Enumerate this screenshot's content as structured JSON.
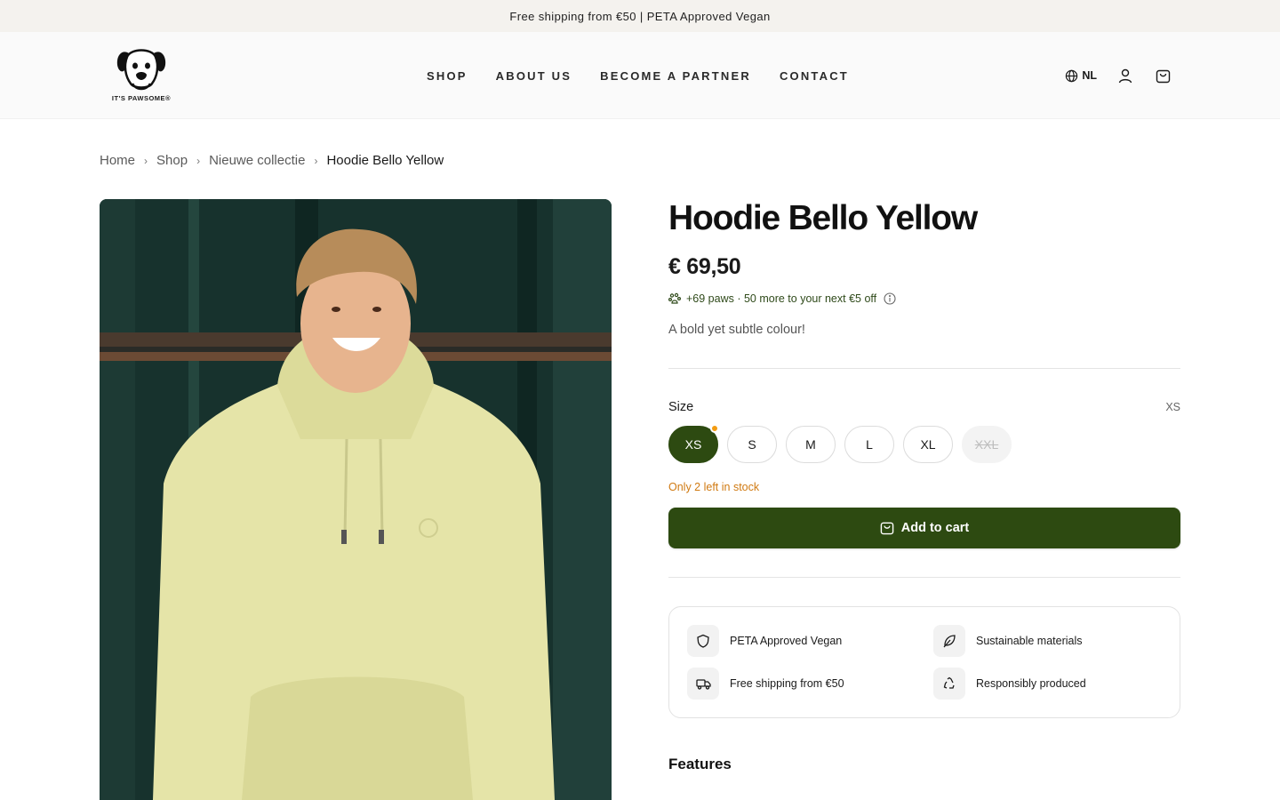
{
  "announcement": "Free shipping from €50 | PETA Approved Vegan",
  "brand": {
    "logo_text": "IT'S PAWSOME®"
  },
  "nav": [
    "SHOP",
    "ABOUT US",
    "BECOME A PARTNER",
    "CONTACT"
  ],
  "header": {
    "language": "NL",
    "icons": [
      "globe-icon",
      "user-icon",
      "cart-icon"
    ]
  },
  "breadcrumb": [
    "Home",
    "Shop",
    "Nieuwe collectie",
    "Hoodie Bello Yellow"
  ],
  "product": {
    "title": "Hoodie Bello Yellow",
    "price": "€ 69,50",
    "paws_text": "+69 paws · 50 more to your next €5 off",
    "description": "A bold yet subtle colour!",
    "size_label": "Size",
    "selected_size": "XS",
    "sizes": [
      "XS",
      "S",
      "M",
      "L",
      "XL",
      "XXL"
    ],
    "unavailable_sizes": [
      "XXL"
    ],
    "stock_note": "Only 2 left in stock",
    "add_to_cart": "Add to cart",
    "benefits": [
      "PETA Approved Vegan",
      "Sustainable materials",
      "Free shipping from €50",
      "Responsibly produced"
    ],
    "features_heading": "Features"
  },
  "colors": {
    "accent": "#2d4a11",
    "stock_warning": "#d07a12",
    "announcement_bg": "#f4f2ee"
  }
}
